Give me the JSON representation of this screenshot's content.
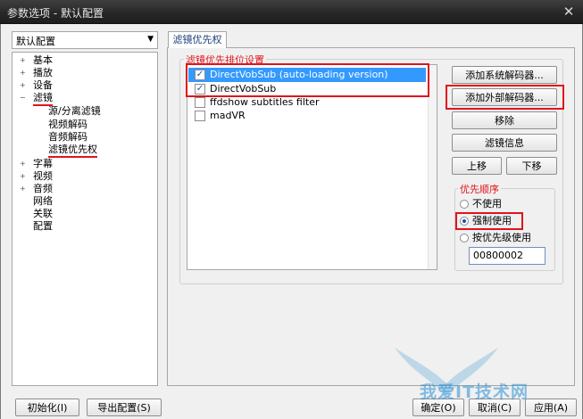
{
  "window": {
    "title": "参数选项 - 默认配置",
    "close_glyph": "✕"
  },
  "profile_select": {
    "value": "默认配置"
  },
  "tree": {
    "items": [
      {
        "label": "基本",
        "expander": "+"
      },
      {
        "label": "播放",
        "expander": "+"
      },
      {
        "label": "设备",
        "expander": "+"
      },
      {
        "label": "滤镜",
        "expander": "−"
      },
      {
        "label": "源/分离滤镜",
        "expander": ""
      },
      {
        "label": "视频解码",
        "expander": ""
      },
      {
        "label": "音频解码",
        "expander": ""
      },
      {
        "label": "滤镜优先权",
        "expander": ""
      },
      {
        "label": "字幕",
        "expander": "+"
      },
      {
        "label": "视频",
        "expander": "+"
      },
      {
        "label": "音频",
        "expander": "+"
      },
      {
        "label": "网络",
        "expander": ""
      },
      {
        "label": "关联",
        "expander": ""
      },
      {
        "label": "配置",
        "expander": ""
      }
    ]
  },
  "tab": {
    "label": "滤镜优先权"
  },
  "filter_group": {
    "title": "滤镜优先排位设置",
    "filters": [
      {
        "label": "DirectVobSub (auto-loading version)",
        "checked": true,
        "selected": true
      },
      {
        "label": "DirectVobSub",
        "checked": true,
        "selected": false
      },
      {
        "label": "ffdshow subtitles filter",
        "checked": false,
        "selected": false
      },
      {
        "label": "madVR",
        "checked": false,
        "selected": false
      }
    ]
  },
  "buttons": {
    "add_system_decoder": "添加系统解码器...",
    "add_external_decoder": "添加外部解码器...",
    "remove": "移除",
    "filter_info": "滤镜信息",
    "move_up": "上移",
    "move_down": "下移"
  },
  "priority": {
    "title": "优先顺序",
    "options": [
      {
        "label": "不使用",
        "selected": false
      },
      {
        "label": "强制使用",
        "selected": true
      },
      {
        "label": "按优先级使用",
        "selected": false
      }
    ],
    "value": "00800002"
  },
  "footer": {
    "initialize": "初始化(I)",
    "export_config": "导出配置(S)",
    "ok": "确定(O)",
    "cancel": "取消(C)",
    "apply": "应用(A)"
  },
  "watermark": {
    "text": "我爱IT技术网"
  },
  "colors": {
    "highlight_red": "#e0141c",
    "selection_blue": "#3399ff",
    "watermark_blue": "#2a8fd6"
  }
}
